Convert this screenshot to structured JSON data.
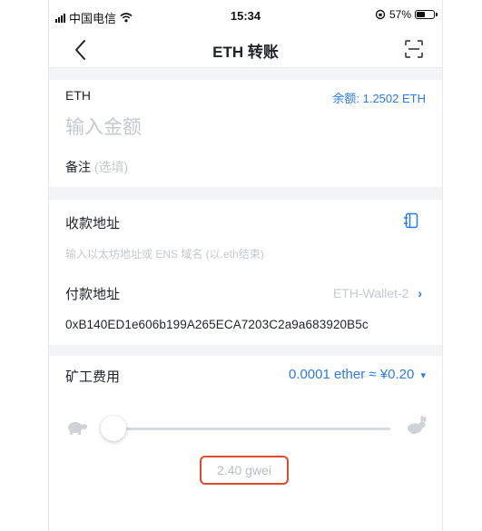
{
  "status_bar": {
    "carrier": "中国电信",
    "time": "15:34",
    "battery_percent": "57%",
    "battery_level": 0.57
  },
  "header": {
    "title": "ETH 转账"
  },
  "amount_section": {
    "token": "ETH",
    "balance": "余额: 1.2502 ETH",
    "amount_placeholder": "输入金额",
    "note_label": "备注",
    "note_placeholder": "(选填)"
  },
  "address_section": {
    "recipient_label": "收款地址",
    "recipient_placeholder": "输入以太坊地址或 ENS 域名 (以.eth结束)",
    "payer_label": "付款地址",
    "wallet_name": "ETH-Wallet-2",
    "payer_address": "0xB140ED1e606b199A265ECA7203C2a9a683920B5c"
  },
  "fee_section": {
    "label": "矿工费用",
    "value": "0.0001 ether ≈ ¥0.20",
    "gas_price": "2.40 gwei",
    "slider_level": 0.0
  },
  "colors": {
    "accent": "#2d7ae5",
    "highlight": "#e04a2f",
    "placeholder": "#c5c9cf"
  }
}
